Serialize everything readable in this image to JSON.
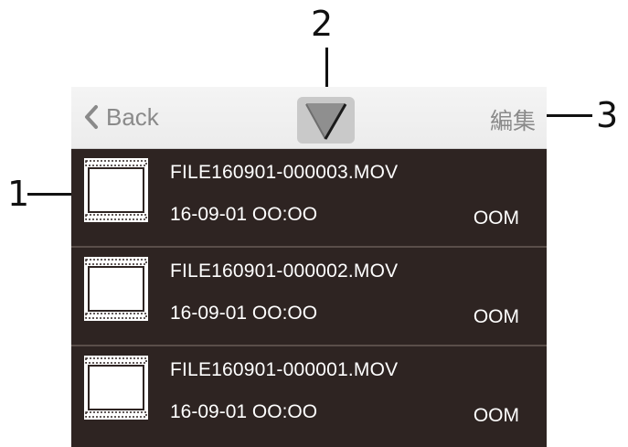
{
  "nav": {
    "back_label": "Back",
    "edit_label": "編集",
    "mode_icon": "video-mode-icon"
  },
  "files": [
    {
      "name": "FILE160901-000003.MOV",
      "datetime": "16-09-01 OO:OO",
      "size": "OOM"
    },
    {
      "name": "FILE160901-000002.MOV",
      "datetime": "16-09-01 OO:OO",
      "size": "OOM"
    },
    {
      "name": "FILE160901-000001.MOV",
      "datetime": "16-09-01 OO:OO",
      "size": "OOM"
    }
  ],
  "callouts": {
    "thumbnail": "1",
    "mode_icon": "2",
    "edit": "3"
  },
  "colors": {
    "row_bg": "#2e2422",
    "navbar_bg": "#f0f0f0",
    "nav_text": "#8a8a8a"
  }
}
